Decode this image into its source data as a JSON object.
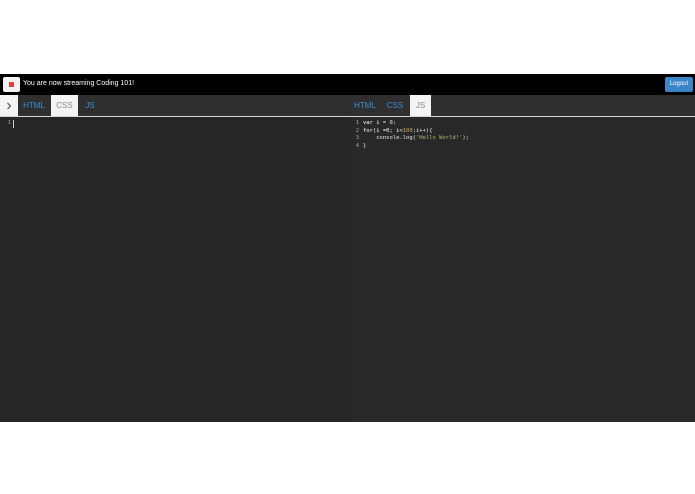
{
  "topbar": {
    "status_text": "You are now streaming Coding 101!",
    "logout_label": "Logout"
  },
  "left_pane": {
    "tabs": [
      {
        "label": "HTML",
        "active": false
      },
      {
        "label": "CSS",
        "active": true
      },
      {
        "label": "JS",
        "active": false
      }
    ],
    "line_numbers": [
      "1"
    ]
  },
  "right_pane": {
    "tabs": [
      {
        "label": "HTML",
        "active": false
      },
      {
        "label": "CSS",
        "active": false
      },
      {
        "label": "JS",
        "active": true
      }
    ],
    "line_numbers": [
      "1",
      "2",
      "3",
      "4"
    ],
    "code": {
      "line1_a": "var i ",
      "line1_b": "= 0;",
      "line2_a": "for(i =0; i<",
      "line2_num": "100",
      "line2_b": ";i++){",
      "line3_a": "    console.log(",
      "line3_str": "'Hello World!'",
      "line3_b": ");",
      "line4": "}"
    }
  },
  "colors": {
    "accent": "#3a8fd6",
    "logout": "#3b86c8",
    "stop": "#e0403a",
    "string": "#b8b86a"
  },
  "icons": {
    "stop": "stop-icon",
    "toggle": "chevron-right-icon"
  }
}
